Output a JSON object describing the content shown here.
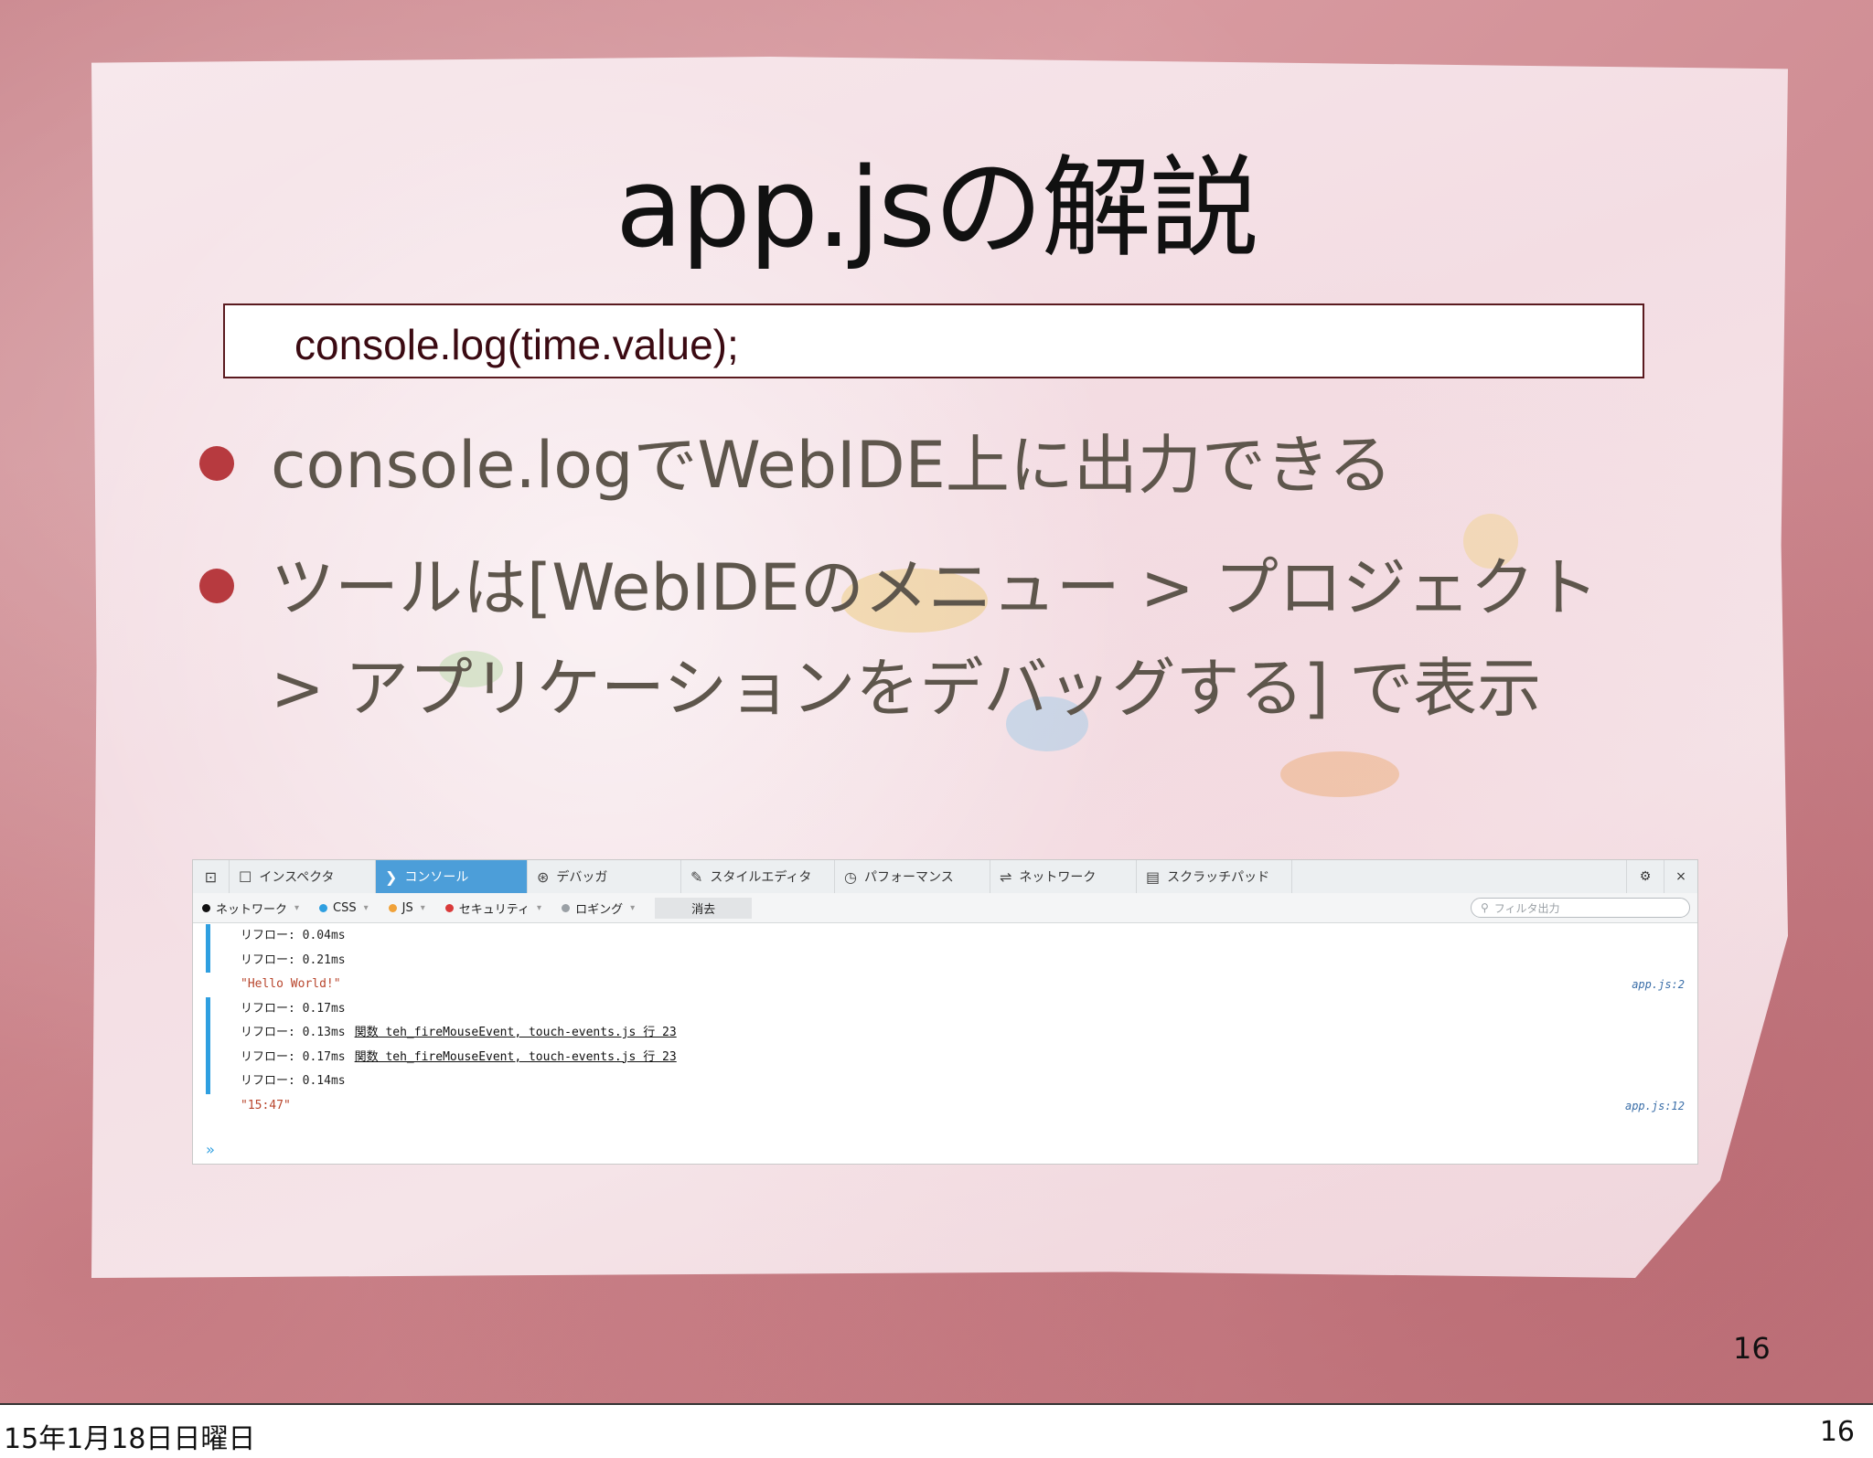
{
  "slide": {
    "title": "app.jsの解説",
    "code": "console.log(time.value);",
    "bullets": [
      "console.logでWebIDE上に出力できる",
      "ツールは[WebIDEのメニュー > プロジェクト",
      "> アプリケーションをデバッグする] で表示"
    ],
    "page_number": "16",
    "accent_color": "#b73a3f"
  },
  "devtools": {
    "tabs": [
      {
        "icon": "inspector-icon",
        "glyph": "☐",
        "label": "インスペクタ"
      },
      {
        "icon": "console-icon",
        "glyph": "❯",
        "label": "コンソール",
        "active": true
      },
      {
        "icon": "debugger-icon",
        "glyph": "⊛",
        "label": "デバッガ"
      },
      {
        "icon": "style-editor-icon",
        "glyph": "✎",
        "label": "スタイルエディタ"
      },
      {
        "icon": "performance-icon",
        "glyph": "◷",
        "label": "パフォーマンス"
      },
      {
        "icon": "network-icon",
        "glyph": "⇌",
        "label": "ネットワーク"
      },
      {
        "icon": "scratchpad-icon",
        "glyph": "▤",
        "label": "スクラッチパッド"
      }
    ],
    "filters": [
      {
        "label": "ネットワーク",
        "color": "#111111"
      },
      {
        "label": "CSS",
        "color": "#2f9fe0"
      },
      {
        "label": "JS",
        "color": "#f0a23a"
      },
      {
        "label": "セキュリティ",
        "color": "#d93a3a"
      },
      {
        "label": "ロギング",
        "color": "#9aa0a5"
      }
    ],
    "clear_label": "消去",
    "filter_placeholder": "フィルタ出力",
    "rows": [
      {
        "text": "リフロー: 0.04ms",
        "bar": true
      },
      {
        "text": "リフロー: 0.21ms",
        "bar": true
      },
      {
        "text": "\"Hello World!\"",
        "str": true,
        "src": "app.js:2"
      },
      {
        "text": "リフロー: 0.17ms",
        "bar": true
      },
      {
        "text": "リフロー: 0.13ms",
        "bar": true,
        "link": "関数 teh_fireMouseEvent, touch-events.js 行 23"
      },
      {
        "text": "リフロー: 0.17ms",
        "bar": true,
        "link": "関数 teh_fireMouseEvent, touch-events.js 行 23"
      },
      {
        "text": "リフロー: 0.14ms",
        "bar": true
      },
      {
        "text": "\"15:47\"",
        "str": true,
        "src": "app.js:12"
      }
    ]
  },
  "footer": {
    "date": "15年1月18日日曜日",
    "page": "16"
  }
}
